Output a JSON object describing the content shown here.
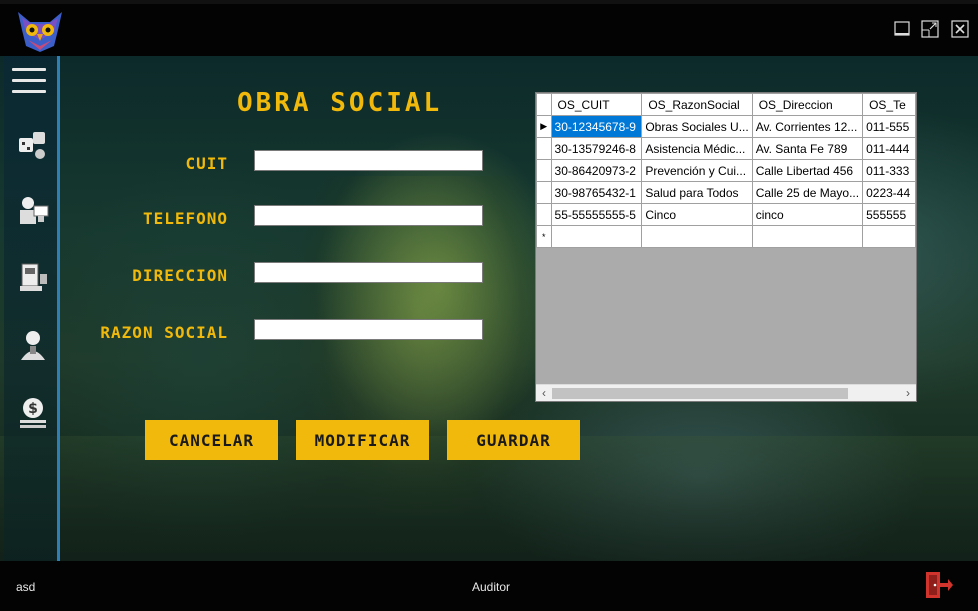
{
  "window": {
    "logo_icon": "owl-logo-icon",
    "controls": [
      "minimize-icon",
      "maximize-icon",
      "close-icon"
    ]
  },
  "sidebar": {
    "items": [
      "menu-hamburger-icon",
      "games-icon",
      "computer-user-icon",
      "cash-register-icon",
      "employee-icon",
      "money-icon"
    ]
  },
  "form": {
    "title": "OBRA SOCIAL",
    "cuit_label": "CUIT",
    "telefono_label": "TELEFONO",
    "direccion_label": "DIRECCION",
    "razon_label": "RAZON SOCIAL",
    "cuit_value": "",
    "telefono_value": "",
    "direccion_value": "",
    "razon_value": ""
  },
  "buttons": {
    "cancelar": "CANCELAR",
    "modificar": "MODIFICAR",
    "guardar": "GUARDAR"
  },
  "grid": {
    "columns": [
      "OS_CUIT",
      "OS_RazonSocial",
      "OS_Direccion",
      "OS_Te"
    ],
    "rows": [
      [
        "30-12345678-9",
        "Obras Sociales U...",
        "Av. Corrientes 12...",
        "011-555"
      ],
      [
        "30-13579246-8",
        "Asistencia Médic...",
        "Av. Santa Fe 789",
        "011-444"
      ],
      [
        "30-86420973-2",
        "Prevención y Cui...",
        "Calle Libertad 456",
        "011-333"
      ],
      [
        "30-98765432-1",
        "Salud para Todos",
        "Calle 25 de Mayo...",
        "0223-44"
      ],
      [
        "55-55555555-5",
        "Cinco",
        "cinco",
        "555555"
      ]
    ],
    "current_row_marker": "▶",
    "new_row_marker": "*"
  },
  "status": {
    "user": "asd",
    "role": "Auditor",
    "logout_icon": "logout-door-icon"
  },
  "colors": {
    "accent": "#f0b90b",
    "selection": "#0078d7",
    "sidebar_border": "#2d7fb5"
  }
}
